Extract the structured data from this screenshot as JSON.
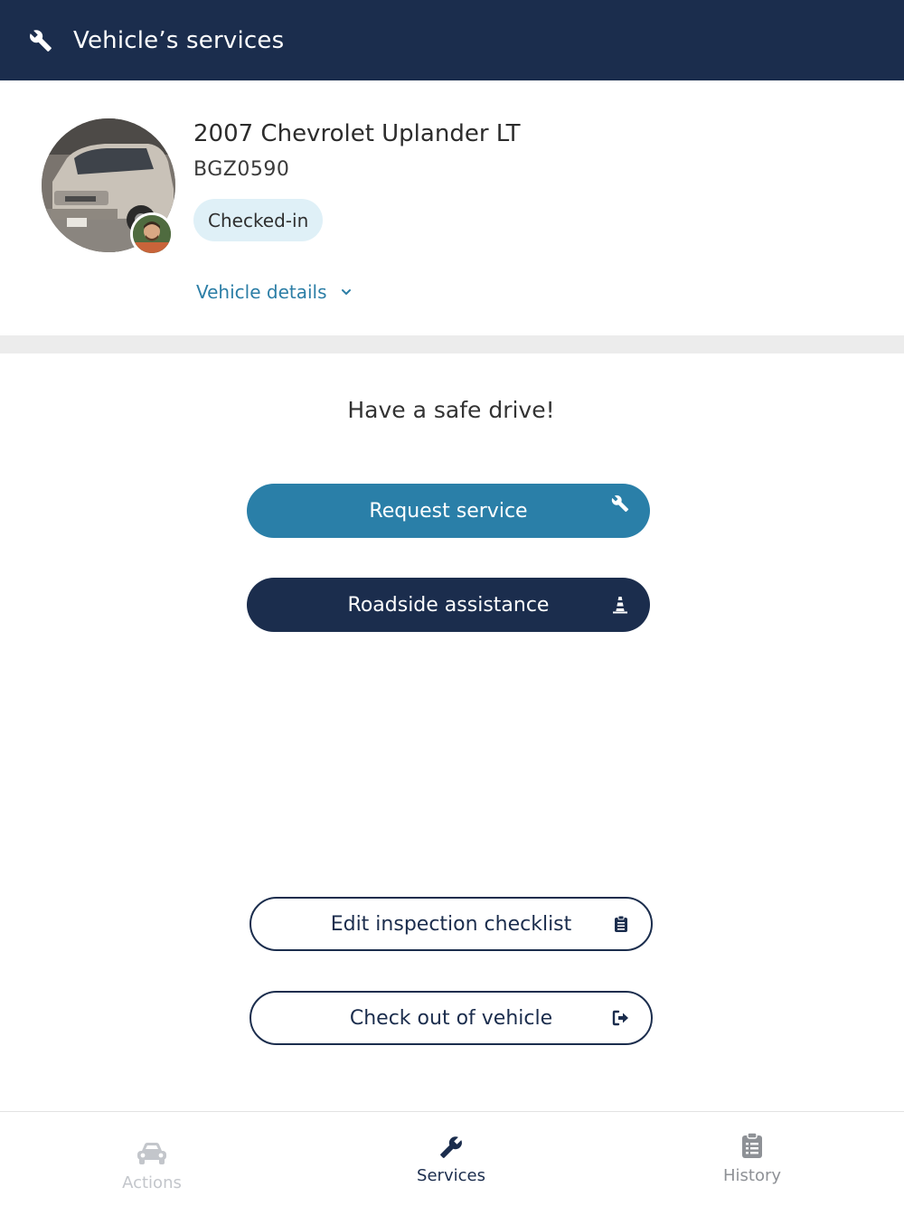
{
  "header": {
    "title": "Vehicle’s services",
    "icon": "wrench-icon"
  },
  "vehicle": {
    "name": "2007 Chevrolet Uplander LT",
    "plate": "BGZ0590",
    "status": "Checked-in",
    "details_link": "Vehicle details"
  },
  "main": {
    "greeting": "Have a safe drive!",
    "request_service": "Request service",
    "roadside_assistance": "Roadside assistance",
    "edit_checklist": "Edit inspection checklist",
    "check_out": "Check out of vehicle"
  },
  "tabs": [
    {
      "label": "Actions",
      "icon": "car-icon",
      "state": "disabled"
    },
    {
      "label": "Services",
      "icon": "wrench-icon",
      "state": "active"
    },
    {
      "label": "History",
      "icon": "clipboard-icon",
      "state": "inactive"
    }
  ],
  "colors": {
    "header_bg": "#1b2d4d",
    "accent": "#2a7fa8",
    "badge_bg": "#dff0f7",
    "link": "#2c7ea6"
  }
}
